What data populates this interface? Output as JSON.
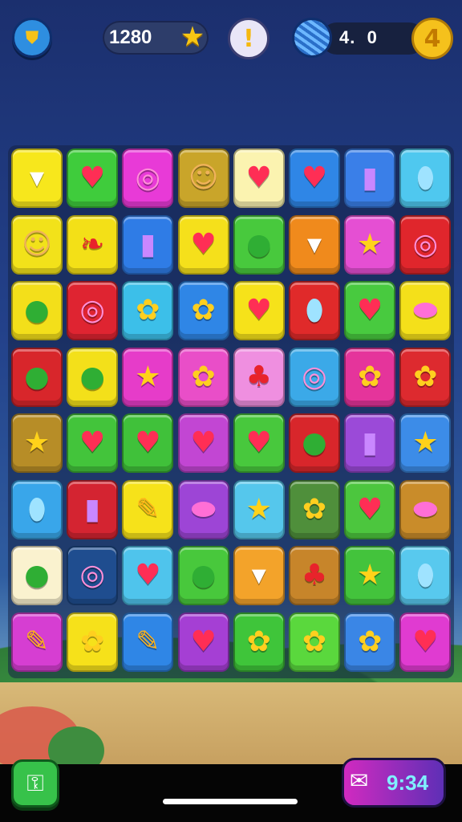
{
  "hud": {
    "score": "1280",
    "moves": "4.  0",
    "level": "4",
    "shield_icon": "shield-icon",
    "star_icon": "star-icon",
    "alert_symbol": "!",
    "ball_icon": "ball-icon"
  },
  "board": {
    "rows": 8,
    "cols": 8,
    "tiles": [
      [
        {
          "bg": "#f7e71c",
          "icon": "cup"
        },
        {
          "bg": "#3fcc3c",
          "icon": "heart"
        },
        {
          "bg": "#e83ad7",
          "icon": "donut"
        },
        {
          "bg": "#c9a52a",
          "icon": "face"
        },
        {
          "bg": "#fbf3b0",
          "icon": "heart"
        },
        {
          "bg": "#2f86e6",
          "icon": "heart"
        },
        {
          "bg": "#3a7fe8",
          "icon": "bottle"
        },
        {
          "bg": "#4fc8ef",
          "icon": "gem"
        }
      ],
      [
        {
          "bg": "#f2e21a",
          "icon": "face"
        },
        {
          "bg": "#f3e017",
          "icon": "bow"
        },
        {
          "bg": "#2f7ce6",
          "icon": "bottle"
        },
        {
          "bg": "#f5e01b",
          "icon": "heart"
        },
        {
          "bg": "#48c93d",
          "icon": "melon"
        },
        {
          "bg": "#f08a1c",
          "icon": "cup"
        },
        {
          "bg": "#e54fd3",
          "icon": "star"
        },
        {
          "bg": "#e0262c",
          "icon": "donut"
        }
      ],
      [
        {
          "bg": "#f3df1a",
          "icon": "melon"
        },
        {
          "bg": "#df2431",
          "icon": "donut"
        },
        {
          "bg": "#3cbfe9",
          "icon": "flower"
        },
        {
          "bg": "#2f86e6",
          "icon": "flower"
        },
        {
          "bg": "#f6e21a",
          "icon": "heart"
        },
        {
          "bg": "#e02a2a",
          "icon": "gem"
        },
        {
          "bg": "#48ca3f",
          "icon": "heart"
        },
        {
          "bg": "#f4e01a",
          "icon": "candy"
        }
      ],
      [
        {
          "bg": "#d8262b",
          "icon": "melon"
        },
        {
          "bg": "#f3e01a",
          "icon": "melon"
        },
        {
          "bg": "#e63cc9",
          "icon": "star"
        },
        {
          "bg": "#e94ec8",
          "icon": "flower"
        },
        {
          "bg": "#ef8fe0",
          "icon": "berry"
        },
        {
          "bg": "#3ba9e8",
          "icon": "donut"
        },
        {
          "bg": "#e5349b",
          "icon": "flower"
        },
        {
          "bg": "#dd2a2f",
          "icon": "flower"
        }
      ],
      [
        {
          "bg": "#b78d27",
          "icon": "star"
        },
        {
          "bg": "#43c43b",
          "icon": "heart"
        },
        {
          "bg": "#40c13a",
          "icon": "heart"
        },
        {
          "bg": "#c246d3",
          "icon": "heart"
        },
        {
          "bg": "#48c83d",
          "icon": "heart"
        },
        {
          "bg": "#d8262b",
          "icon": "melon"
        },
        {
          "bg": "#9b4ad8",
          "icon": "bottle"
        },
        {
          "bg": "#3c8ce8",
          "icon": "star"
        }
      ],
      [
        {
          "bg": "#39a6ea",
          "icon": "gem"
        },
        {
          "bg": "#d42431",
          "icon": "bottle"
        },
        {
          "bg": "#f6e21a",
          "icon": "pencil"
        },
        {
          "bg": "#9d45d6",
          "icon": "candy"
        },
        {
          "bg": "#55c7ec",
          "icon": "star"
        },
        {
          "bg": "#4f8f3b",
          "icon": "flower"
        },
        {
          "bg": "#4cc63e",
          "icon": "heart"
        },
        {
          "bg": "#c98c2a",
          "icon": "candy"
        }
      ],
      [
        {
          "bg": "#faf2cf",
          "icon": "melon"
        },
        {
          "bg": "#1f4d8f",
          "icon": "donut"
        },
        {
          "bg": "#4fc4ec",
          "icon": "heart"
        },
        {
          "bg": "#48c83c",
          "icon": "melon"
        },
        {
          "bg": "#f3a32a",
          "icon": "cup"
        },
        {
          "bg": "#c7852a",
          "icon": "berry"
        },
        {
          "bg": "#43c33c",
          "icon": "star"
        },
        {
          "bg": "#58c9ee",
          "icon": "gem"
        }
      ],
      [
        {
          "bg": "#d63ed2",
          "icon": "pencil"
        },
        {
          "bg": "#f6e11a",
          "icon": "flower"
        },
        {
          "bg": "#2f86e6",
          "icon": "pencil"
        },
        {
          "bg": "#a53fd4",
          "icon": "heart"
        },
        {
          "bg": "#3fc53a",
          "icon": "flower"
        },
        {
          "bg": "#5ad83d",
          "icon": "flower"
        },
        {
          "bg": "#3a86e6",
          "icon": "flower"
        },
        {
          "bg": "#e03bd1",
          "icon": "heart"
        }
      ]
    ]
  },
  "icon_glyphs": {
    "cup": {
      "glyph": "▾",
      "color": "#ffffff"
    },
    "heart": {
      "glyph": "♥",
      "color": "#ff2e55"
    },
    "donut": {
      "glyph": "◎",
      "color": "#ff8fd8"
    },
    "face": {
      "glyph": "☺",
      "color": "#f0b25a"
    },
    "bottle": {
      "glyph": "▮",
      "color": "#c987ff"
    },
    "gem": {
      "glyph": "⬮",
      "color": "#9fe3ff"
    },
    "bow": {
      "glyph": "❧",
      "color": "#e8232b"
    },
    "melon": {
      "glyph": "●",
      "color": "#2fae34"
    },
    "star": {
      "glyph": "★",
      "color": "#ffd21a"
    },
    "flower": {
      "glyph": "✿",
      "color": "#ffcf1f"
    },
    "candy": {
      "glyph": "⬬",
      "color": "#ff6fd6"
    },
    "berry": {
      "glyph": "♣",
      "color": "#e8232b"
    },
    "pencil": {
      "glyph": "✎",
      "color": "#ffb21a"
    }
  },
  "bottom": {
    "coins": "9:34",
    "key_icon": "key-icon",
    "coin_icon": "gift-bag-icon"
  }
}
